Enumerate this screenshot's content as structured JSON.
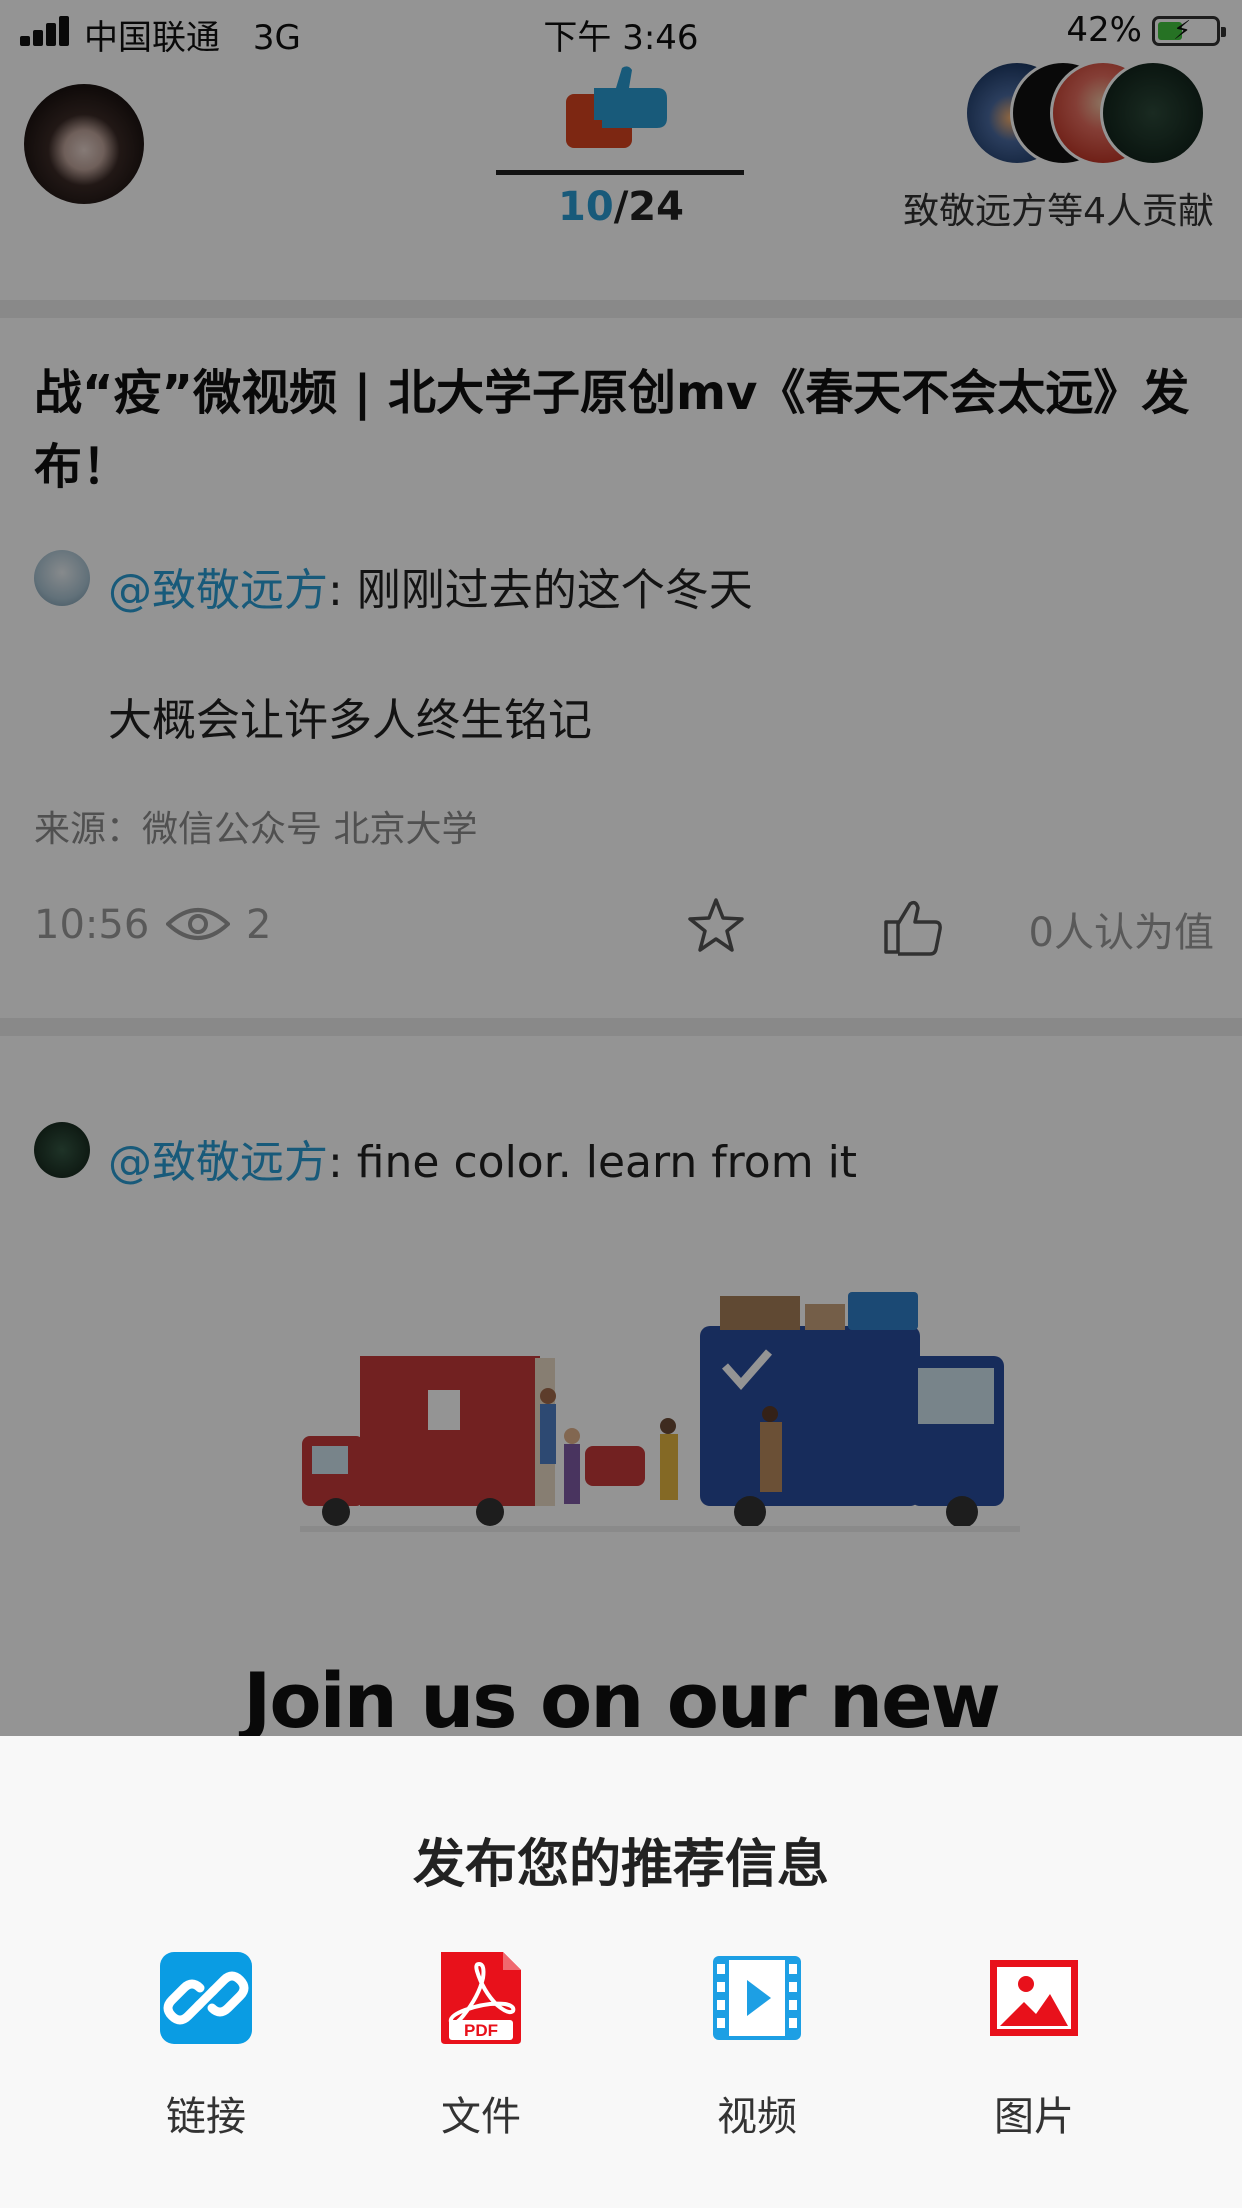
{
  "status_bar": {
    "carrier": "中国联通",
    "network": "3G",
    "time": "下午 3:46",
    "battery": "42%",
    "battery_level": 0.42
  },
  "header": {
    "counter_current": "10",
    "counter_sep": "/",
    "counter_total": "24",
    "contributors_text": "致敬远方等4人贡献"
  },
  "card1": {
    "title": "战“疫”微视频 | 北大学子原创mv《春天不会太远》发布！",
    "author": "@致敬远方",
    "text_line1": ": 刚刚过去的这个冬天",
    "text_line2": "大概会让许多人终生铭记",
    "source": "来源：微信公众号 北京大学",
    "time": "10:56",
    "views": "2",
    "worth": "0人认为值"
  },
  "card2": {
    "author": "@致敬远方",
    "text": ": fine color. learn from it",
    "heading": "Join us on our new"
  },
  "sheet": {
    "title": "发布您的推荐信息",
    "options": [
      {
        "label": "链接",
        "icon": "link-icon",
        "color": "#0a9ce3"
      },
      {
        "label": "文件",
        "icon": "pdf-icon",
        "color": "#e8111b"
      },
      {
        "label": "视频",
        "icon": "video-icon",
        "color": "#1d9fe4"
      },
      {
        "label": "图片",
        "icon": "image-icon",
        "color": "#e8111b"
      }
    ]
  },
  "colors": {
    "accent": "#2a9cd3",
    "link_icon": "#0a9ce3",
    "pdf_icon": "#e8111b"
  }
}
